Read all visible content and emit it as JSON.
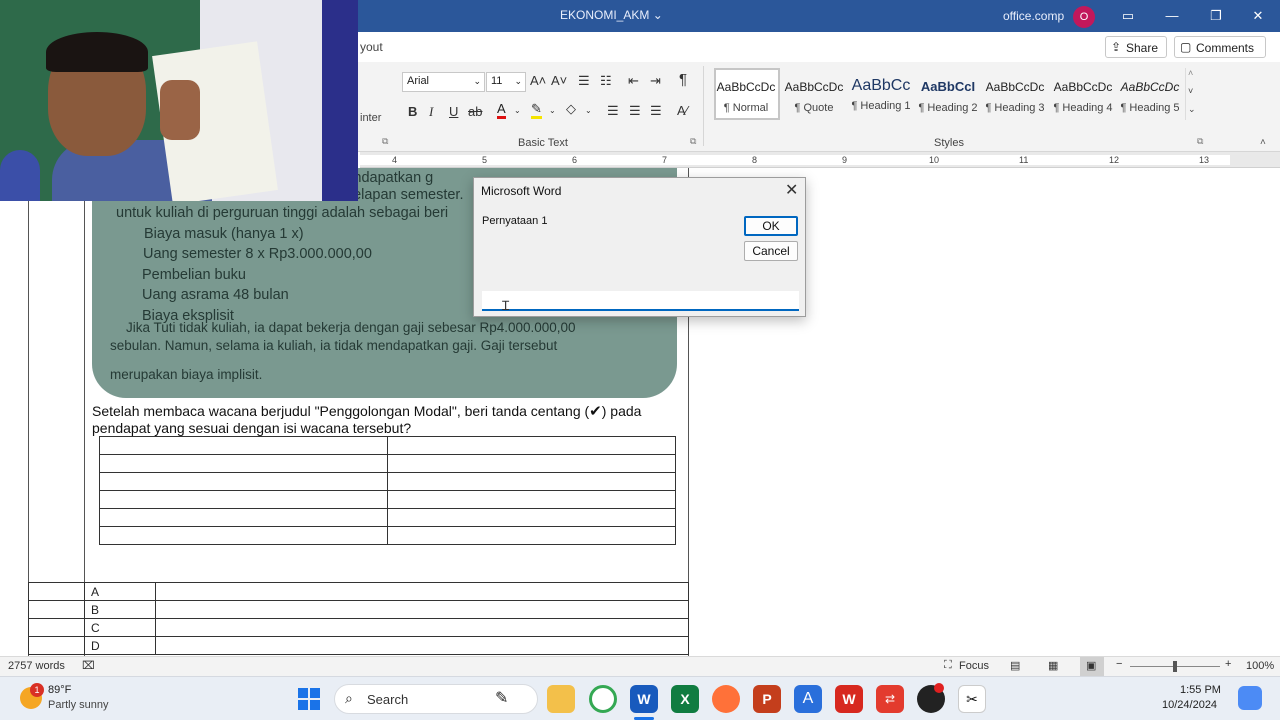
{
  "window": {
    "title": "EKONOMI_AKM",
    "title_caret": "⌄",
    "account": "office.comp",
    "avatar_letter": "O",
    "accent": "#2b579a"
  },
  "ribbon_tabs": {
    "layout_fragment": "yout",
    "share_label": "Share",
    "comments_label": "Comments"
  },
  "ribbon": {
    "painter_fragment": "inter",
    "font_name": "Arial",
    "font_size": "11",
    "basic_text_label": "Basic Text",
    "styles_label": "Styles",
    "styles": [
      {
        "preview": "AaBbCcDc",
        "name": "¶ Normal"
      },
      {
        "preview": "AaBbCcDc",
        "name": "¶ Quote"
      },
      {
        "preview": "AaBbCc",
        "name": "¶ Heading 1"
      },
      {
        "preview": "AaBbCcI",
        "name": "¶ Heading 2"
      },
      {
        "preview": "AaBbCcDc",
        "name": "¶ Heading 3"
      },
      {
        "preview": "AaBbCcDc",
        "name": "¶ Heading 4"
      },
      {
        "preview": "AaBbCcDc",
        "name": "¶ Heading 5"
      }
    ]
  },
  "ruler": {
    "ticks": [
      "4",
      "5",
      "6",
      "7",
      "8",
      "9",
      "10",
      "11",
      "12",
      "13"
    ]
  },
  "document": {
    "textbook_lines": [
      "k mendapatkan g",
      "delapan semester.",
      "untuk kuliah di perguruan tinggi adalah sebagai beri",
      "Biaya masuk (hanya 1 x)",
      "Uang semester 8 x Rp3.000.000,00",
      "Pembelian buku",
      "Uang asrama 48 bulan",
      "Biaya eksplisit",
      "Jika Tuti tidak kuliah, ia dapat bekerja dengan gaji sebesar Rp4.000.000,00",
      "sebulan. Namun, selama ia kuliah, ia tidak mendapatkan gaji. Gaji tersebut",
      "merupakan biaya implisit."
    ],
    "question_line1": "Setelah membaca wacana berjudul \"Penggolongan Modal\", beri tanda centang (",
    "checkmark": "✔",
    "question_line1_end": ") pada",
    "question_line2": "pendapat yang sesuai dengan isi wacana tersebut?",
    "options": [
      "A",
      "B",
      "C",
      "D"
    ]
  },
  "dialog": {
    "title": "Microsoft Word",
    "prompt": "Pernyataan 1",
    "ok_label": "OK",
    "cancel_label": "Cancel",
    "input_value": ""
  },
  "statusbar": {
    "words": "2757 words",
    "focus_label": "Focus",
    "zoom": "100%",
    "zoom_level": 1.0
  },
  "taskbar": {
    "temperature": "89°F",
    "weather": "Partly sunny",
    "weather_badge": "1",
    "search_placeholder": "Search",
    "time": "1:55 PM",
    "date": "10/24/2024"
  }
}
